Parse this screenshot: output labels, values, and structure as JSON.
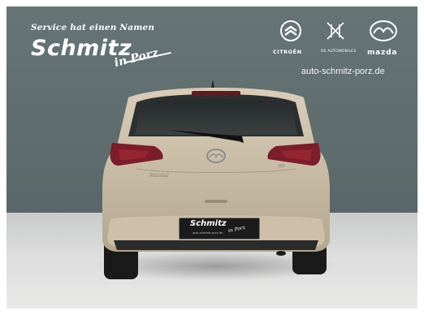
{
  "overlay": {
    "slogan": "Service hat einen Namen",
    "brand": "Schmitz",
    "location": "in Porz",
    "website": "auto-schmitz-porz.de"
  },
  "brands": [
    {
      "name": "CITROËN",
      "icon": "citroen-chevrons-icon"
    },
    {
      "name": "DS AUTOMOBILES",
      "icon": "ds-automobiles-icon"
    },
    {
      "name": "mazda",
      "icon": "mazda-wings-icon"
    }
  ],
  "plate": {
    "brand": "Schmitz",
    "location": "in Porz",
    "url": "auto-schmitz-porz.de"
  }
}
